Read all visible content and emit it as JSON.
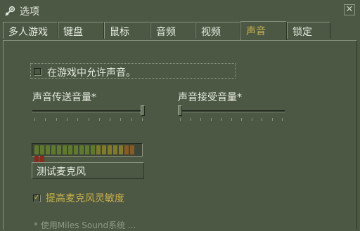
{
  "window": {
    "title": "选项",
    "close_symbol": "✕"
  },
  "tabs": [
    {
      "label": "多人游戏",
      "active": false
    },
    {
      "label": "键盘",
      "active": false
    },
    {
      "label": "鼠标",
      "active": false
    },
    {
      "label": "音频",
      "active": false
    },
    {
      "label": "视频",
      "active": false
    },
    {
      "label": "声音",
      "active": true
    },
    {
      "label": "锁定",
      "active": false
    }
  ],
  "voice": {
    "allow_in_game_label": "在游戏中允许声音。",
    "allow_in_game_checked": false,
    "transmit_volume_label": "声音传送音量*",
    "transmit_volume_level": 1.0,
    "receive_volume_label": "声音接受音量*",
    "receive_volume_level": 0.0,
    "meter_segments": 20,
    "test_mic_label": "测试麦克风",
    "boost_mic_label": "提高麦克风灵敏度",
    "boost_mic_checked": true,
    "footnote": "* 使用Miles Sound系统 ..."
  },
  "colors": {
    "background": "#4c5844",
    "accent": "#c8b04a",
    "text": "#e6ebe1"
  }
}
